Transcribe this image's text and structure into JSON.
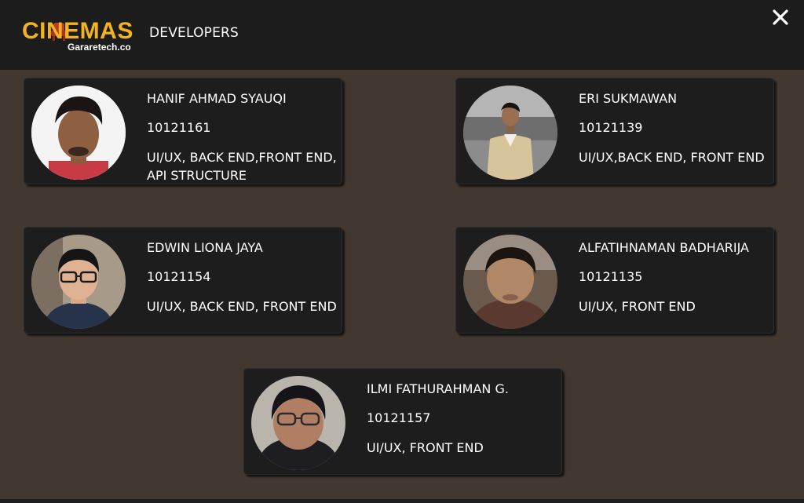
{
  "header": {
    "logo": {
      "main": "CINEMAS",
      "sub": "Gararetech.co"
    },
    "title": "DEVELOPERS",
    "close_icon": "close-icon"
  },
  "colors": {
    "header_bg": "#1c1c1c",
    "page_bg": "#433830",
    "card_bg": "#1d1d1d",
    "logo_accent": "#f2b320",
    "text": "#ffffff"
  },
  "developers": [
    {
      "name": "HANIF AHMAD SYAUQI",
      "nim": "10121161",
      "role": "UI/UX, BACK END,FRONT END, API STRUCTURE"
    },
    {
      "name": "ERI SUKMAWAN",
      "nim": "10121139",
      "role": "UI/UX,BACK END, FRONT END"
    },
    {
      "name": "EDWIN LIONA JAYA",
      "nim": "10121154",
      "role": "UI/UX, BACK END, FRONT END"
    },
    {
      "name": "ALFATIHNAMAN BADHARIJA",
      "nim": "10121135",
      "role": "UI/UX, FRONT END"
    },
    {
      "name": "ILMI FATHURAHMAN G.",
      "nim": "10121157",
      "role": "UI/UX, FRONT END"
    }
  ]
}
